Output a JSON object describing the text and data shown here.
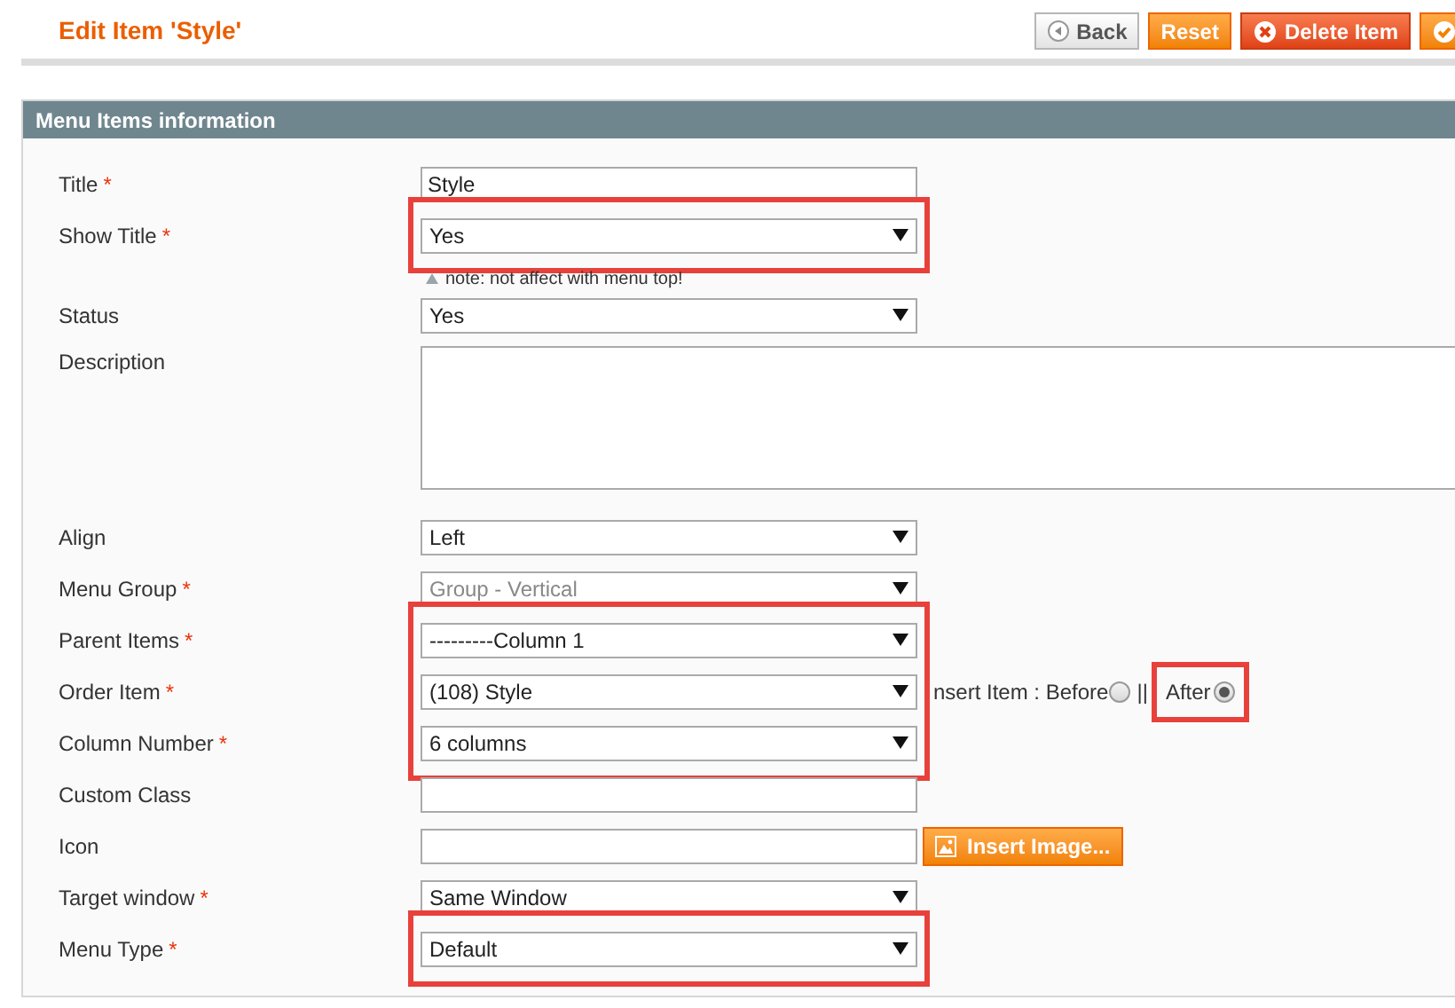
{
  "page_title": "Edit Item 'Style'",
  "buttons": [
    {
      "kind": "back",
      "label": "Back"
    },
    {
      "kind": "reset",
      "label": "Reset"
    },
    {
      "kind": "delete",
      "label": "Delete Item"
    },
    {
      "kind": "save"
    }
  ],
  "section": {
    "title": "Menu Items information",
    "groups": [
      {
        "highlighted": false,
        "fields": [
          {
            "label": "Title",
            "mark": "*",
            "kind": "text",
            "value": "Style"
          }
        ]
      },
      {
        "highlighted": true,
        "fields": [
          {
            "label": "Show Title",
            "mark": "*",
            "kind": "select",
            "value": "Yes",
            "disabled": false,
            "note": "note: not affect with menu top!"
          }
        ]
      },
      {
        "highlighted": false,
        "fields": [
          {
            "label": "Status",
            "kind": "select",
            "value": "Yes",
            "disabled": false
          }
        ]
      },
      {
        "highlighted": false,
        "fields": [
          {
            "label": "Description",
            "kind": "textarea"
          }
        ]
      },
      {
        "highlighted": false,
        "fields": [
          {
            "label": "Align",
            "kind": "select",
            "value": "Left",
            "disabled": false
          },
          {
            "label": "Menu Group",
            "mark": "*",
            "kind": "select",
            "value": "Group - Vertical",
            "disabled": true
          }
        ]
      },
      {
        "highlighted": true,
        "fields": [
          {
            "label": "Parent Items",
            "mark": "*",
            "kind": "select",
            "value": "---------Column 1",
            "disabled": false
          },
          {
            "label": "Order Item",
            "mark": "*",
            "kind": "select",
            "value": "(108) Style",
            "disabled": false,
            "insert": {
              "label": "nsert Item : Before",
              "separator": "||",
              "options": [
                {
                  "selected": false
                },
                {
                  "label": "After",
                  "selected": true,
                  "highlighted": true
                }
              ]
            }
          },
          {
            "label": "Column Number",
            "mark": "*",
            "kind": "select",
            "value": "6 columns",
            "disabled": false
          }
        ]
      },
      {
        "highlighted": false,
        "fields": [
          {
            "label": "Custom Class",
            "kind": "text"
          },
          {
            "label": "Icon",
            "kind": "text",
            "action": "Insert Image..."
          },
          {
            "label": "Target window",
            "mark": "*",
            "kind": "select",
            "value": "Same Window",
            "disabled": false
          }
        ]
      },
      {
        "highlighted": true,
        "fields": [
          {
            "label": "Menu Type",
            "mark": "*",
            "kind": "select",
            "value": "Default",
            "disabled": false
          }
        ]
      }
    ]
  }
}
